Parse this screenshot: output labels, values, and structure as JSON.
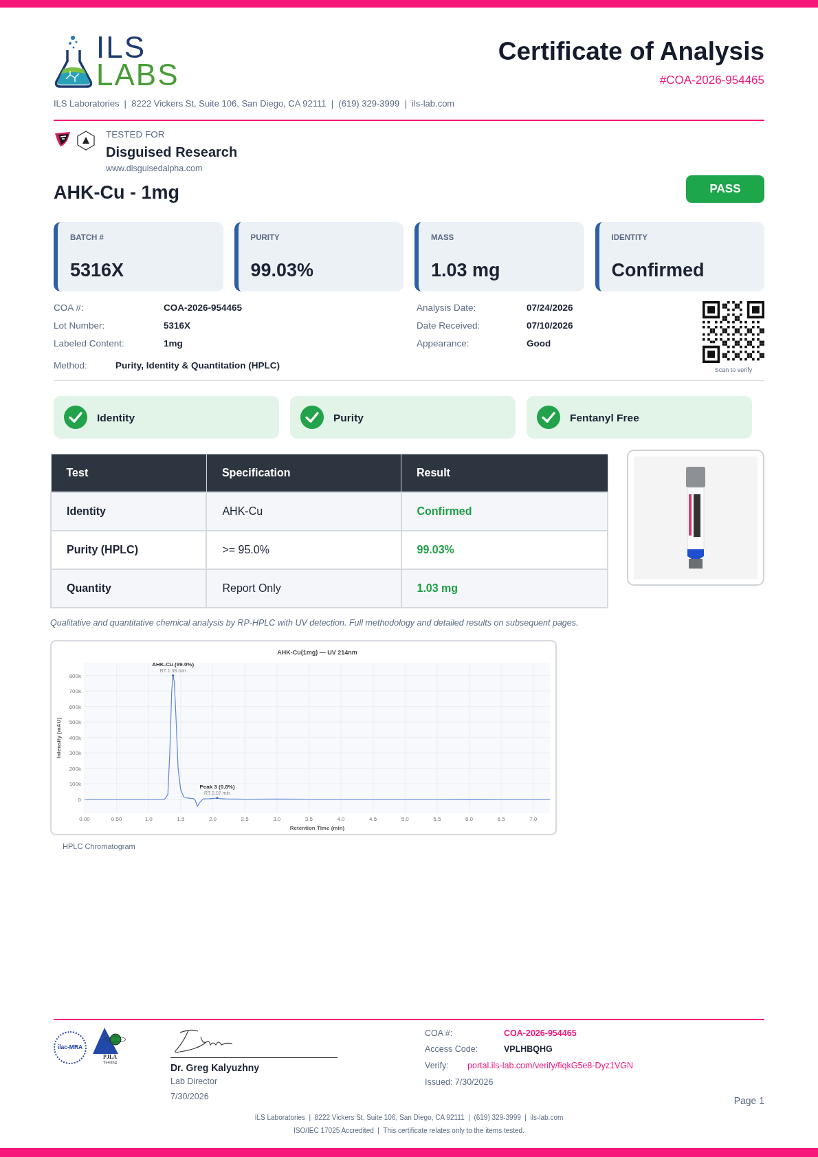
{
  "header": {
    "logo": {
      "line_1": "ILS",
      "line_2": "LABS"
    },
    "title": "Certificate of Analysis",
    "coa_number": "#COA-2026-954465",
    "address": "ILS Laboratories  |  8222 Vickers St, Suite 106, San Diego, CA 92111  |  (619) 329-3999  |  ils-lab.com"
  },
  "client": {
    "label": "TESTED FOR",
    "name": "Disguised Research",
    "website": "www.disguisedalpha.com"
  },
  "product": {
    "name": "AHK-Cu - 1mg",
    "verdict": {
      "label": "PASS"
    }
  },
  "stats": [
    {
      "label": "BATCH #",
      "value": "5316X"
    },
    {
      "label": "PURITY",
      "value": "99.03%"
    },
    {
      "label": "MASS",
      "value": "1.03 mg"
    },
    {
      "label": "IDENTITY",
      "value": "Confirmed"
    }
  ],
  "details_left": [
    {
      "label": "COA #:",
      "value": "COA-2026-954465"
    },
    {
      "label": "Lot Number:",
      "value": "5316X"
    },
    {
      "label": "Labeled Content:",
      "value": "1mg"
    }
  ],
  "details_right": [
    {
      "label": "Analysis Date:",
      "value": "07/24/2026"
    },
    {
      "label": "Date Received:",
      "value": "07/10/2026"
    },
    {
      "label": "Appearance:",
      "value": "Good"
    }
  ],
  "method": {
    "label": "Method:",
    "value": "Purity, Identity & Quantitation (HPLC)"
  },
  "qr": {
    "caption": "Scan to verify"
  },
  "checks": [
    {
      "label": "Identity",
      "passed": true
    },
    {
      "label": "Purity",
      "passed": true
    },
    {
      "label": "Fentanyl Free",
      "passed": true
    }
  ],
  "results_table": {
    "columns": [
      "Test",
      "Specification",
      "Result"
    ],
    "rows": [
      {
        "test": "Identity",
        "specification": "AHK-Cu",
        "result": "Confirmed"
      },
      {
        "test": "Purity (HPLC)",
        "specification": ">= 95.0%",
        "result": "99.03%"
      },
      {
        "test": "Quantity",
        "specification": "Report Only",
        "result": "1.03 mg"
      }
    ]
  },
  "table_note": "Qualitative and quantitative chemical analysis by RP-HPLC with UV detection. Full methodology and detailed results on subsequent pages.",
  "chromatogram": {
    "caption": "HPLC Chromatogram",
    "chart_data": {
      "type": "line",
      "grid": true,
      "title": "AHK-Cu(1mg) — UV 214nm",
      "xlabel": "Retention Time (min)",
      "ylabel": "Intensity (mAU)",
      "xlim": [
        0,
        7.26
      ],
      "ylim": [
        -91000,
        883000
      ],
      "xticks": [
        {
          "value": 0,
          "label": "0.00"
        },
        {
          "value": 0.5,
          "label": "0.50"
        },
        {
          "value": 1,
          "label": "1.0"
        },
        {
          "value": 1.5,
          "label": "1.5"
        },
        {
          "value": 2,
          "label": "2.0"
        },
        {
          "value": 2.5,
          "label": "2.5"
        },
        {
          "value": 3,
          "label": "3.0"
        },
        {
          "value": 3.5,
          "label": "3.5"
        },
        {
          "value": 4,
          "label": "4.0"
        },
        {
          "value": 4.5,
          "label": "4.5"
        },
        {
          "value": 5,
          "label": "5.0"
        },
        {
          "value": 5.5,
          "label": "5.5"
        },
        {
          "value": 6,
          "label": "6.0"
        },
        {
          "value": 6.5,
          "label": "6.5"
        },
        {
          "value": 7,
          "label": "7.0"
        }
      ],
      "yticks": [
        {
          "value": 0,
          "label": "0"
        },
        {
          "value": 100000,
          "label": "100k"
        },
        {
          "value": 200000,
          "label": "200k"
        },
        {
          "value": 300000,
          "label": "300k"
        },
        {
          "value": 400000,
          "label": "400k"
        },
        {
          "value": 500000,
          "label": "500k"
        },
        {
          "value": 600000,
          "label": "600k"
        },
        {
          "value": 700000,
          "label": "700k"
        },
        {
          "value": 800000,
          "label": "800k"
        }
      ],
      "x": [
        0,
        0.5,
        1.0,
        1.25,
        1.3,
        1.33,
        1.36,
        1.38,
        1.4,
        1.43,
        1.46,
        1.5,
        1.55,
        1.6,
        1.65,
        1.7,
        1.73,
        1.76,
        1.8,
        1.85,
        1.95,
        2.05,
        2.07,
        2.1,
        2.2,
        2.5,
        3.0,
        3.5,
        4.0,
        5.0,
        5.5,
        6.0,
        6.5,
        7.26
      ],
      "series": [
        {
          "color": "#5b86d6",
          "values": [
            0,
            0,
            0,
            1000,
            30000,
            300000,
            700000,
            800000,
            760000,
            500000,
            200000,
            60000,
            15000,
            8000,
            5000,
            4000,
            -10000,
            -45000,
            -20000,
            2000,
            3000,
            6000,
            8000,
            4000,
            2000,
            0,
            1000,
            0,
            0,
            0,
            0,
            -1000,
            0,
            0
          ]
        }
      ],
      "annotations": [
        {
          "x": 1.38,
          "y": 800000,
          "text": "AHK-Cu (99.0%)\nRT 1.38 min"
        },
        {
          "x": 2.07,
          "y": 8000,
          "text": "Peak 3 (0.8%)\nRT 2.07 min"
        }
      ]
    }
  },
  "footer": {
    "accreditation": {
      "ilac": "ilac-MRA",
      "pjla": "PJLA",
      "pjla_sub": "Testing"
    },
    "signatory": {
      "name": "Dr. Greg Kalyuzhny",
      "role": "Lab Director",
      "date": "7/30/2026"
    },
    "verification": [
      {
        "label": "COA #:",
        "value": "COA-2026-954465",
        "kind": "highlight"
      },
      {
        "label": "Access Code:",
        "value": "VPLHBQHG",
        "kind": "bold"
      },
      {
        "label": "Verify:",
        "value": "portal.ils-lab.com/verify/fiqkG5e8-Dyz1VGN",
        "kind": "link"
      }
    ],
    "issued": "Issued: 7/30/2026",
    "page": "Page 1",
    "lines": [
      "ILS Laboratories  |  8222 Vickers St, Suite 106, San Diego, CA 92111  |  (619) 329-3999  |  ils-lab.com",
      "ISO/IEC 17025 Accredited  |  This certificate relates only to the items tested."
    ]
  }
}
